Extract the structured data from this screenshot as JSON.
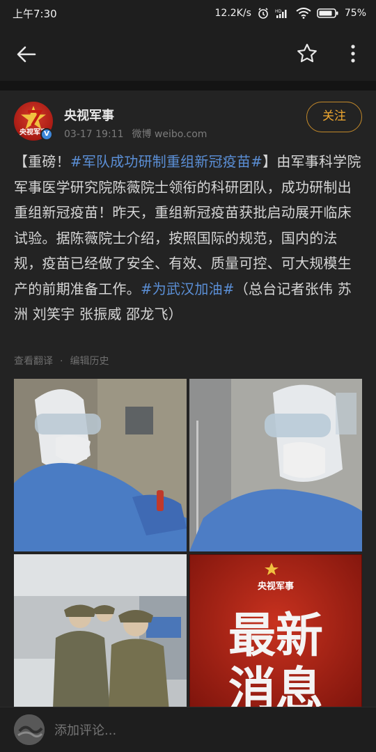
{
  "status_bar": {
    "time": "上午7:30",
    "network_speed": "12.2K/s",
    "network_type": "4G",
    "battery": "75%"
  },
  "top_bar": {
    "back_icon": "back-arrow-icon",
    "favorite_icon": "star-icon",
    "more_icon": "more-vertical-icon"
  },
  "author": {
    "name": "央视军事",
    "avatar_text": "央视军事",
    "verified": "V",
    "date": "03-17 19:11",
    "source": "微博 weibo.com",
    "follow_label": "关注"
  },
  "post": {
    "text_1": "【重磅！",
    "tag_1": "#军队成功研制重组新冠疫苗#",
    "text_2": "】由军事科学院军事医学研究院陈薇院士领衔的科研团队，成功研制出重组新冠疫苗！昨天，重组新冠疫苗获批启动展开临床试验。据陈薇院士介绍，按照国际的规范，国内的法规，疫苗已经做了安全、有效、质量可控、可大规模生产的前期准备工作。",
    "tag_2": "#为武汉加油#",
    "text_3": "（总台记者张伟 苏洲 刘笑宇 张振威 邵龙飞）",
    "translate_label": "查看翻译",
    "separator": "·",
    "edit_history_label": "编辑历史"
  },
  "images": {
    "news_logo_text": "央视军事",
    "news_title_line1": "最新",
    "news_title_line2": "消息"
  },
  "comment": {
    "placeholder": "添加评论..."
  },
  "colors": {
    "accent_follow": "#f0a830",
    "tag_blue": "#5b8fd6",
    "background": "#1e1e1e"
  }
}
